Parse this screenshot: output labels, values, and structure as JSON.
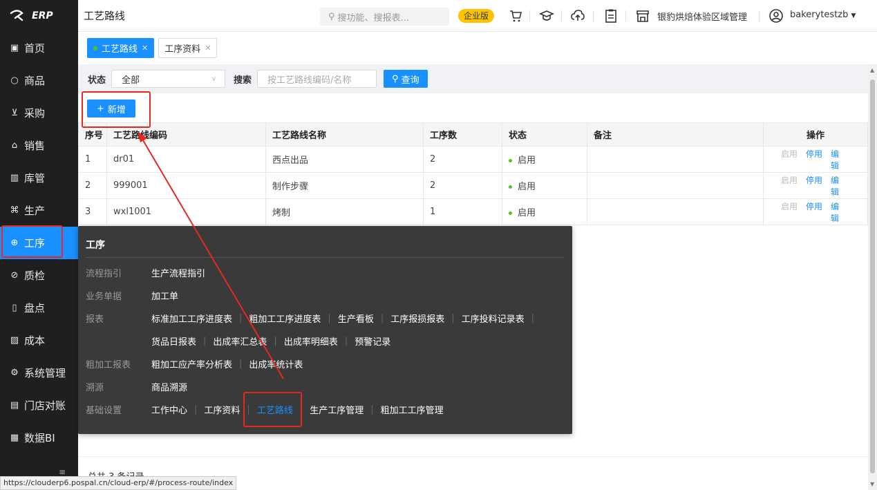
{
  "app": {
    "logo": "ERP"
  },
  "sidebar": {
    "items": [
      {
        "label": "首页",
        "icon": "dashboard-icon"
      },
      {
        "label": "商品",
        "icon": "circle-icon"
      },
      {
        "label": "采购",
        "icon": "cart-icon"
      },
      {
        "label": "销售",
        "icon": "bag-icon"
      },
      {
        "label": "库管",
        "icon": "warehouse-icon"
      },
      {
        "label": "生产",
        "icon": "command-icon"
      },
      {
        "label": "工序",
        "icon": "process-icon",
        "active": true
      },
      {
        "label": "质检",
        "icon": "check-icon"
      },
      {
        "label": "盘点",
        "icon": "inventory-icon"
      },
      {
        "label": "成本",
        "icon": "chart-icon"
      },
      {
        "label": "系统管理",
        "icon": "settings-icon"
      },
      {
        "label": "门店对账",
        "icon": "ledger-icon"
      },
      {
        "label": "数据BI",
        "icon": "bi-icon"
      }
    ]
  },
  "header": {
    "title": "工艺路线",
    "search_placeholder": "搜功能、搜报表...",
    "edition": "企业版",
    "store": "银豹烘焙体验区域管理",
    "user": "bakerytestzb"
  },
  "tabs": [
    {
      "label": "工艺路线",
      "active": true
    },
    {
      "label": "工序资料",
      "active": false
    }
  ],
  "filter": {
    "status_label": "状态",
    "status_value": "全部",
    "search_label": "搜索",
    "search_placeholder": "按工艺路线编码/名称",
    "query_button": "查询"
  },
  "add_button": "新增",
  "table": {
    "columns": [
      "序号",
      "工艺路线编码",
      "工艺路线名称",
      "工序数",
      "状态",
      "备注",
      "操作"
    ],
    "rows": [
      {
        "idx": "1",
        "code": "dr01",
        "name": "西点出品",
        "count": "2",
        "status": "启用",
        "note": ""
      },
      {
        "idx": "2",
        "code": "999001",
        "name": "制作步骤",
        "count": "2",
        "status": "启用",
        "note": ""
      },
      {
        "idx": "3",
        "code": "wxl1001",
        "name": "烤制",
        "count": "1",
        "status": "启用",
        "note": ""
      }
    ],
    "actions": {
      "enable": "启用",
      "disable": "停用",
      "edit": "编辑"
    }
  },
  "popup": {
    "title": "工序",
    "rows": [
      {
        "cat": "流程指引",
        "links": [
          "生产流程指引"
        ]
      },
      {
        "cat": "业务单据",
        "links": [
          "加工单"
        ]
      },
      {
        "cat": "报表",
        "links": [
          "标准加工工序进度表",
          "粗加工工序进度表",
          "生产看板",
          "工序报损报表",
          "工序投料记录表"
        ]
      },
      {
        "cat": "",
        "links": [
          "货品日报表",
          "出成率汇总表",
          "出成率明细表",
          "预警记录"
        ]
      },
      {
        "cat": "粗加工报表",
        "links": [
          "粗加工应产率分析表",
          "出成率统计表"
        ]
      },
      {
        "cat": "溯源",
        "links": [
          "商品溯源"
        ]
      },
      {
        "cat": "基础设置",
        "links": [
          "工作中心",
          "工序资料",
          "工艺路线",
          "生产工序管理",
          "粗加工工序管理"
        ]
      }
    ],
    "selected": "工艺路线"
  },
  "footer": {
    "count": "总共 3 条记录"
  },
  "status_url": "https://clouderp6.pospal.cn/cloud-erp/#/process-route/index",
  "colors": {
    "accent": "#1890ff",
    "sidebar": "#1f1f1f",
    "annotation": "#e8281e"
  }
}
